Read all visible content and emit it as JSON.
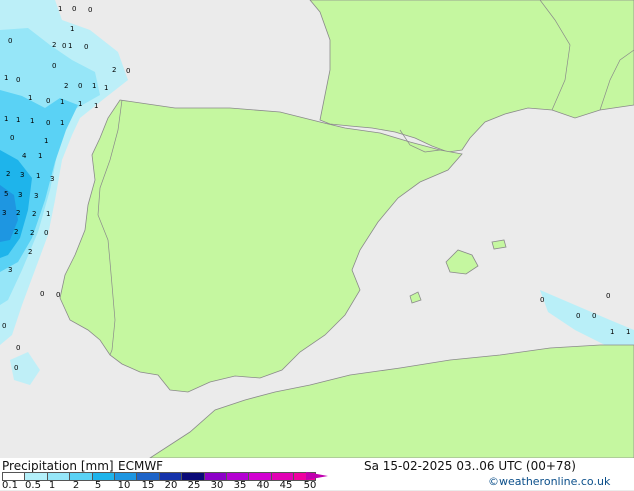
{
  "footer": {
    "title": "Precipitation [mm]",
    "model": "ECMWF",
    "valid_time": "Sa 15-02-2025 03..06 UTC (00+78)",
    "credit": "©weatheronline.co.uk"
  },
  "legend": {
    "ticks": [
      "0.1",
      "0.5",
      "1",
      "2",
      "5",
      "10",
      "15",
      "20",
      "25",
      "30",
      "35",
      "40",
      "45",
      "50"
    ],
    "colors": [
      "#ffffff",
      "#b4f0fa",
      "#96e6f8",
      "#5ad2f5",
      "#1eb4eb",
      "#1e96e1",
      "#1e64c8",
      "#1432aa",
      "#0a0a78",
      "#8c00c8",
      "#b400d2",
      "#d200d2",
      "#e100b4",
      "#f000a0"
    ]
  },
  "map": {
    "land_color": "#c5f7a0",
    "sea_color": "#ebebeb",
    "border_color": "#8a8a8a"
  },
  "values": [
    "1",
    "0",
    "0",
    "1",
    "0",
    "2",
    "0",
    "1",
    "0",
    "0",
    "2",
    "0",
    "2",
    "0",
    "1",
    "1",
    "1",
    "0",
    "1",
    "1",
    "0",
    "1",
    "1",
    "1",
    "1",
    "0",
    "1",
    "1",
    "0",
    "1",
    "4",
    "1",
    "2",
    "3",
    "1",
    "3",
    "5",
    "3",
    "3",
    "2",
    "2",
    "1",
    "3",
    "2",
    "2",
    "0",
    "2",
    "3",
    "0",
    "0",
    "0",
    "0",
    "0",
    "0",
    "0",
    "0",
    "0",
    "1",
    "1"
  ]
}
